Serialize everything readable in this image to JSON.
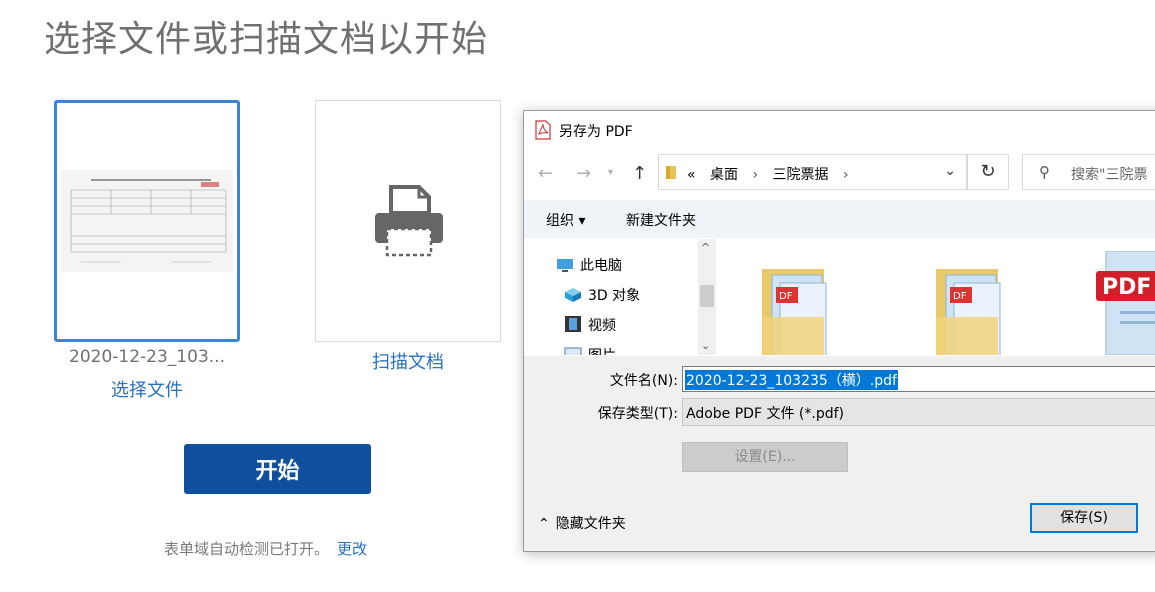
{
  "page": {
    "title": "选择文件或扫描文档以开始",
    "file_card": {
      "file_name": "2020-12-23_103...",
      "link": "选择文件"
    },
    "scan_card": {
      "link": "扫描文档"
    },
    "start_button": "开始",
    "footer": {
      "note": "表单域自动检测已打开。",
      "change_link": "更改"
    }
  },
  "dialog": {
    "title": "另存为 PDF",
    "address": {
      "prefix": "«",
      "crumbs": [
        "桌面",
        "三院票据"
      ]
    },
    "search_placeholder": "搜索\"三院票",
    "toolbar": {
      "organize": "组织 ▾",
      "new_folder": "新建文件夹"
    },
    "nav_items": [
      "此电脑",
      "3D 对象",
      "视频",
      "图片"
    ],
    "fields": {
      "filename_label": "文件名(N):",
      "filename_value": "2020-12-23_103235（横）.pdf",
      "type_label": "保存类型(T):",
      "type_value": "Adobe PDF 文件 (*.pdf)"
    },
    "settings_button": "设置(E)...",
    "hide_folders": "隐藏文件夹",
    "save_button": "保存(S)"
  },
  "colors": {
    "accent": "#0f4f9e",
    "link": "#2870c0",
    "selection": "#0078d7"
  }
}
